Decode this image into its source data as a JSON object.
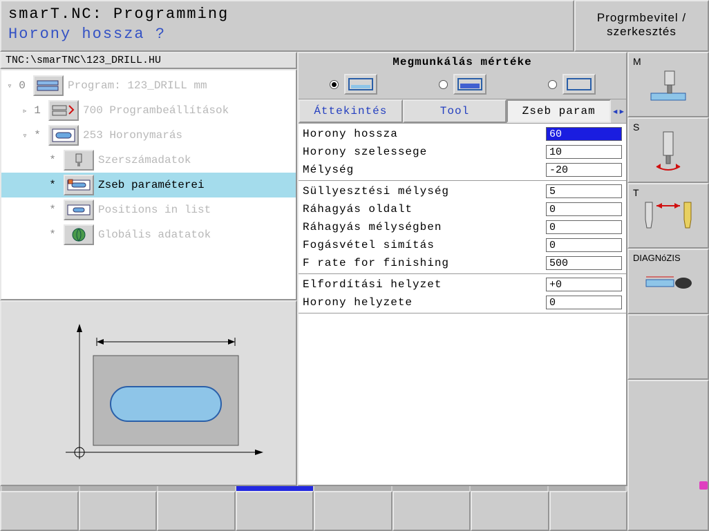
{
  "header": {
    "title": "smarT.NC: Programming",
    "subtitle": "Horony hossza ?",
    "mode": "Progrmbevitel / szerkesztés"
  },
  "path": "TNC:\\smarTNC\\123_DRILL.HU",
  "tree": [
    {
      "tw": "▿",
      "ix": "0",
      "label": "Program: 123_DRILL mm",
      "icon": "program",
      "dim": true,
      "depth": 0
    },
    {
      "tw": "▹",
      "ix": "1",
      "label": "700 Programbeállítások",
      "icon": "settings",
      "dim": true,
      "depth": 1
    },
    {
      "tw": "▿",
      "ix": "*",
      "label": "253 Horonymarás",
      "icon": "slot",
      "dim": true,
      "depth": 1
    },
    {
      "tw": "",
      "ix": "*",
      "label": "Szerszámadatok",
      "icon": "tool",
      "dim": true,
      "depth": 2
    },
    {
      "tw": "",
      "ix": "*",
      "label": "Zseb paraméterei",
      "icon": "pocket",
      "dim": false,
      "sel": true,
      "depth": 2
    },
    {
      "tw": "",
      "ix": "*",
      "label": "Positions in list",
      "icon": "positions",
      "dim": true,
      "depth": 2
    },
    {
      "tw": "",
      "ix": "*",
      "label": "Globális adatatok",
      "icon": "global",
      "dim": true,
      "depth": 2
    }
  ],
  "machining": {
    "title": "Megmunkálás mértéke",
    "selected": 0
  },
  "tabs": {
    "items": [
      "Áttekintés",
      "Tool",
      "Zseb param"
    ],
    "active": 2
  },
  "params": [
    [
      {
        "label": "Horony hossza",
        "value": "60",
        "selected": true
      },
      {
        "label": "Horony szelessege",
        "value": "10"
      },
      {
        "label": "Mélység",
        "value": "-20"
      }
    ],
    [
      {
        "label": "Süllyesztési mélység",
        "value": "5"
      },
      {
        "label": "Ráhagyás oldalt",
        "value": "0"
      },
      {
        "label": "Ráhagyás mélységben",
        "value": "0"
      },
      {
        "label": "Fogásvétel simítás",
        "value": "0"
      },
      {
        "label": "F rate for finishing",
        "value": "500"
      }
    ],
    [
      {
        "label": "Elfordítási helyzet",
        "value": "+0"
      },
      {
        "label": "Horony helyzete",
        "value": "0"
      }
    ]
  ],
  "softkeys_right": [
    {
      "label": "M",
      "icon": "machine"
    },
    {
      "label": "S",
      "icon": "spindle"
    },
    {
      "label": "T",
      "icon": "toolchange"
    },
    {
      "label": "DIAGNóZIS",
      "icon": "diag"
    }
  ]
}
